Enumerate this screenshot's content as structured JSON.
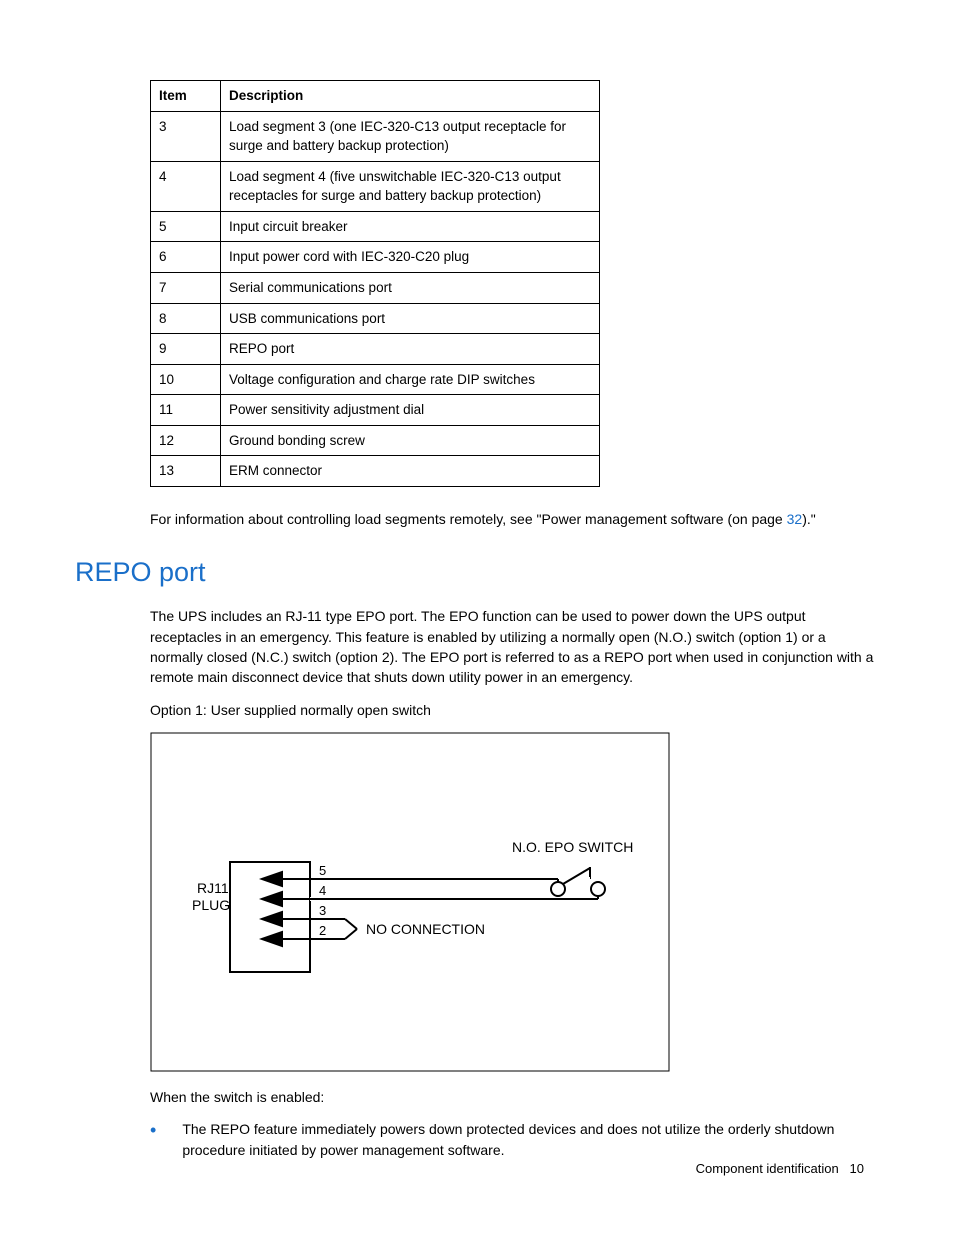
{
  "table": {
    "headers": {
      "item": "Item",
      "description": "Description"
    },
    "rows": [
      {
        "item": "3",
        "description": "Load segment 3 (one IEC-320-C13 output receptacle for surge and battery backup protection)"
      },
      {
        "item": "4",
        "description": "Load segment 4 (five unswitchable IEC-320-C13 output receptacles for surge and battery backup protection)"
      },
      {
        "item": "5",
        "description": "Input circuit breaker"
      },
      {
        "item": "6",
        "description": "Input power cord with IEC-320-C20 plug"
      },
      {
        "item": "7",
        "description": "Serial communications port"
      },
      {
        "item": "8",
        "description": "USB communications port"
      },
      {
        "item": "9",
        "description": "REPO port"
      },
      {
        "item": "10",
        "description": "Voltage configuration and charge rate DIP switches"
      },
      {
        "item": "11",
        "description": "Power sensitivity adjustment dial"
      },
      {
        "item": "12",
        "description": "Ground bonding screw"
      },
      {
        "item": "13",
        "description": "ERM connector"
      }
    ]
  },
  "para1_pre": "For information about controlling load segments remotely, see \"Power management software (on page ",
  "para1_link": "32",
  "para1_post": ").\"",
  "section_heading": "REPO port",
  "para2": "The UPS includes an RJ-11 type EPO port. The EPO function can be used to power down the UPS output receptacles in an emergency. This feature is enabled by utilizing a normally open (N.O.) switch (option 1) or a normally closed (N.C.) switch (option 2). The EPO port is referred to as a REPO port when used in conjunction with a remote main disconnect device that shuts down utility power in an emergency.",
  "option_caption": "Option 1:  User supplied normally open switch",
  "diagram": {
    "rj11_label": "RJ11\nPLUG",
    "switch_label": "N.O. EPO SWITCH",
    "no_conn_label": "NO CONNECTION",
    "pin5": "5",
    "pin4": "4",
    "pin3": "3",
    "pin2": "2"
  },
  "para3": "When the switch is enabled:",
  "bullet1": "The REPO feature immediately powers down protected devices and does not utilize the orderly shutdown procedure initiated by power management software.",
  "footer_text": "Component identification",
  "footer_page": "10"
}
